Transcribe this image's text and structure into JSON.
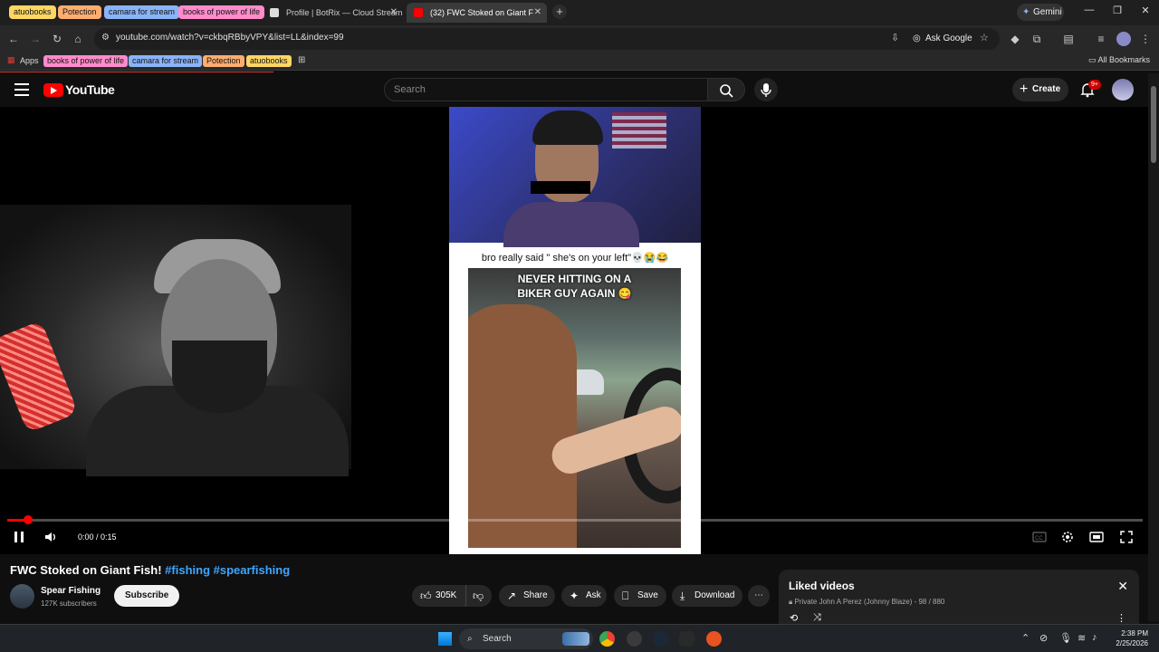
{
  "browser": {
    "tab_groups": [
      {
        "label": "atuobooks",
        "color": "#fdd663"
      },
      {
        "label": "Potection",
        "color": "#fcad70"
      },
      {
        "label": "camara for stream",
        "color": "#8ab4f8"
      },
      {
        "label": "books of power of life",
        "color": "#ff8bcb"
      }
    ],
    "tabs": [
      {
        "title": "Profile | BotRix — Cloud Stream",
        "active": false
      },
      {
        "title": "(32) FWC Stoked on Giant F",
        "active": true
      }
    ],
    "gemini_label": "Gemini",
    "url": "youtube.com/watch?v=ckbqRBbyVPY&list=LL&index=99",
    "ask_google_label": "Ask Google",
    "bookmarks": [
      {
        "label": "Apps",
        "color": ""
      },
      {
        "label": "books of power of life",
        "color": "#ff8bcb"
      },
      {
        "label": "camara for stream",
        "color": "#8ab4f8"
      },
      {
        "label": "Potection",
        "color": "#fcad70"
      },
      {
        "label": "atuobooks",
        "color": "#fdd663"
      }
    ],
    "all_bookmarks_label": "All Bookmarks"
  },
  "youtube": {
    "logo_text": "YouTube",
    "search_placeholder": "Search",
    "create_label": "Create",
    "notification_count": "9+",
    "video": {
      "short_caption": "bro really said \" she's on your left\"💀😭😂",
      "short_overlay_line1": "NEVER HITTING ON A",
      "short_overlay_line2": "BIKER GUY AGAIN 😋",
      "time_display": "0:00 / 0:15",
      "progress_fraction": 0.018
    },
    "title_main": "FWC Stoked on Giant Fish!",
    "title_tags": "#fishing #spearfishing",
    "channel_name": "Spear Fishing",
    "channel_subs": "127K subscribers",
    "subscribe_label": "Subscribe",
    "actions": {
      "like_count": "305K",
      "share_label": "Share",
      "ask_label": "Ask",
      "save_label": "Save",
      "download_label": "Download"
    },
    "playlist": {
      "title": "Liked videos",
      "privacy": "Private",
      "owner_progress": "John A Perez (Johnny Blaze) - 98 / 880"
    }
  },
  "taskbar": {
    "search_label": "Search",
    "time": "2:38 PM",
    "date": "2/25/2026"
  }
}
